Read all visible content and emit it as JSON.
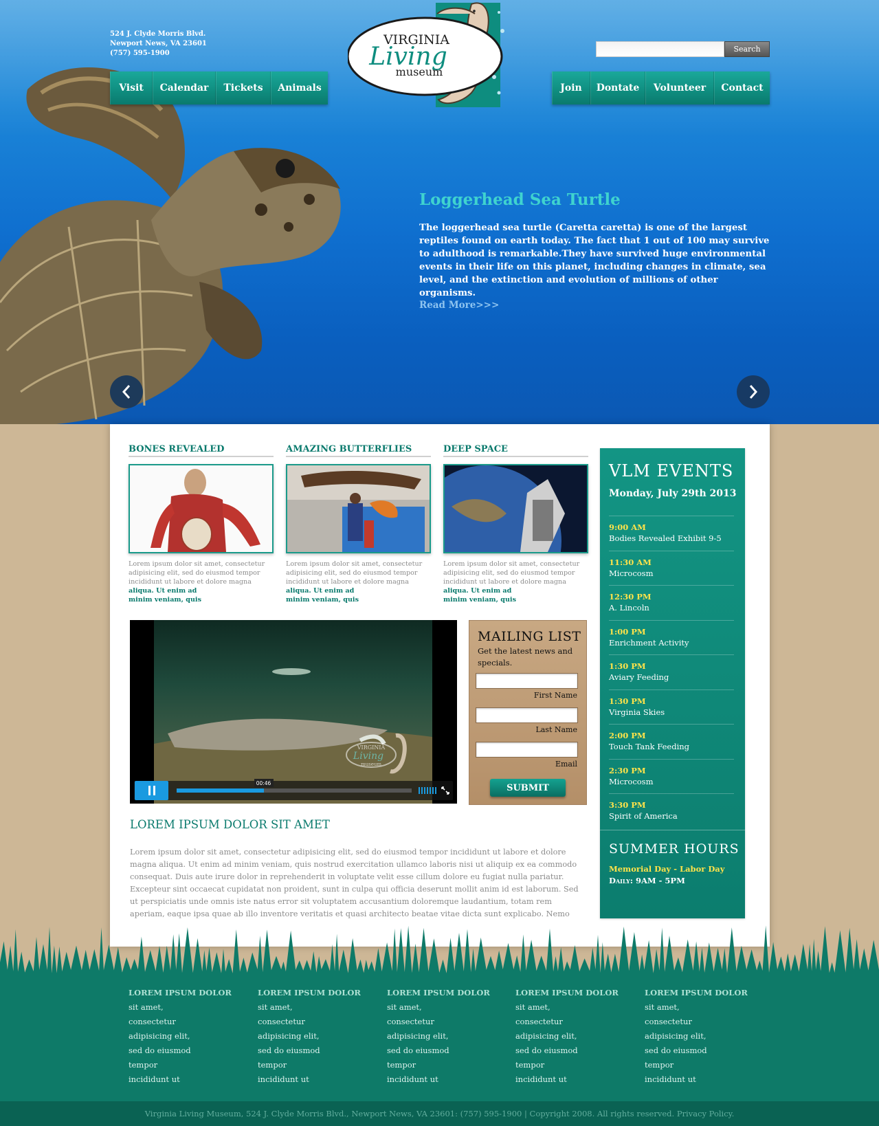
{
  "header": {
    "address": [
      "524 J. Clyde Morris Blvd.",
      "Newport News, VA 23601",
      "(757) 595-1900"
    ],
    "logo": {
      "line1": "VIRGINIA",
      "line2": "Living",
      "line3": "museum"
    },
    "nav_left": [
      "Visit",
      "Calendar",
      "Tickets",
      "Animals"
    ],
    "nav_right": [
      "Join",
      "Dontate",
      "Volunteer",
      "Contact"
    ],
    "search": {
      "value": "",
      "placeholder": "",
      "button": "Search"
    }
  },
  "hero": {
    "title": "Loggerhead Sea Turtle",
    "text": "The loggerhead sea turtle (Caretta caretta) is one of the largest reptiles found on earth today. The fact that 1 out of 100 may survive to adulthood is remarkable.They have survived huge environmental events in their life on this planet, including changes in climate, sea level, and the extinction and evolution of millions of other organisms.",
    "read_more": "Read More>>>"
  },
  "features": [
    {
      "title": "BONES REVEALED",
      "text": "Lorem ipsum dolor sit amet, consectetur adipisicing elit, sed do eiusmod tempor incididunt ut labore et dolore magna",
      "more1": "aliqua. Ut enim ad",
      "more2": "minim veniam, quis"
    },
    {
      "title": "AMAZING BUTTERFLIES",
      "text": "Lorem ipsum dolor sit amet, consectetur adipisicing elit, sed do eiusmod tempor incididunt ut labore et dolore magna",
      "more1": "aliqua. Ut enim ad",
      "more2": "minim veniam, quis"
    },
    {
      "title": "DEEP SPACE",
      "text": "Lorem ipsum dolor sit amet, consectetur adipisicing elit, sed do eiusmod tempor incididunt ut labore et dolore magna",
      "more1": "aliqua. Ut enim ad",
      "more2": "minim veniam, quis"
    }
  ],
  "video": {
    "time": "00:46",
    "progress": 0.37,
    "watermark": {
      "line1": "VIRGINIA",
      "line2": "Living",
      "line3": "museum"
    }
  },
  "mailing": {
    "title": "MAILING LIST",
    "subtitle": "Get the latest news and specials.",
    "first_name": "First Name",
    "last_name": "Last Name",
    "email": "Email",
    "submit": "SUBMIT"
  },
  "events": {
    "title": "VLM EVENTS",
    "date": "Monday, July 29th 2013",
    "items": [
      {
        "time": "9:00 AM",
        "name": "Bodies Revealed Exhibit 9-5"
      },
      {
        "time": "11:30 AM",
        "name": "Microcosm"
      },
      {
        "time": "12:30 PM",
        "name": "A. Lincoln"
      },
      {
        "time": "1:00 PM",
        "name": "Enrichment Activity"
      },
      {
        "time": "1:30 PM",
        "name": "Aviary Feeding"
      },
      {
        "time": "1:30 PM",
        "name": "Virginia Skies"
      },
      {
        "time": "2:00 PM",
        "name": "Touch Tank Feeding"
      },
      {
        "time": "2:30 PM",
        "name": "Microcosm"
      },
      {
        "time": "3:30 PM",
        "name": "Spirit of America"
      }
    ],
    "hours_title": "SUMMER HOURS",
    "hours_range": "Memorial Day - Labor Day",
    "hours_time": "Daily: 9AM - 5PM"
  },
  "article": {
    "title": "LOREM IPSUM DOLOR SIT AMET",
    "text": "Lorem ipsum dolor sit amet, consectetur adipisicing elit, sed do eiusmod tempor incididunt ut labore et dolore magna aliqua. Ut enim ad minim veniam, quis nostrud exercitation ullamco laboris nisi ut aliquip ex ea commodo consequat. Duis aute irure dolor in reprehenderit in voluptate velit esse cillum dolore eu fugiat nulla pariatur. Excepteur sint occaecat cupidatat non proident, sunt in culpa qui officia deserunt mollit anim id est laborum. Sed ut perspiciatis unde omnis iste natus error sit voluptatem accusantium doloremque laudantium, totam rem aperiam, eaque ipsa quae ab illo inventore veritatis et quasi architecto beatae vitae dicta sunt explicabo. Nemo"
  },
  "footer": {
    "columns": [
      {
        "title": "LOREM IPSUM DOLOR",
        "links": [
          "sit amet,",
          "consectetur",
          "adipisicing elit,",
          "sed do eiusmod",
          "tempor",
          "incididunt ut"
        ]
      },
      {
        "title": "LOREM IPSUM DOLOR",
        "links": [
          "sit amet,",
          "consectetur",
          "adipisicing elit,",
          "sed do eiusmod",
          "tempor",
          "incididunt ut"
        ]
      },
      {
        "title": "LOREM IPSUM DOLOR",
        "links": [
          "sit amet,",
          "consectetur",
          "adipisicing elit,",
          "sed do eiusmod",
          "tempor",
          "incididunt ut"
        ]
      },
      {
        "title": "LOREM IPSUM DOLOR",
        "links": [
          "sit amet,",
          "consectetur",
          "adipisicing elit,",
          "sed do eiusmod",
          "tempor",
          "incididunt ut"
        ]
      },
      {
        "title": "LOREM IPSUM DOLOR",
        "links": [
          "sit amet,",
          "consectetur",
          "adipisicing elit,",
          "sed do eiusmod",
          "tempor",
          "incididunt ut"
        ]
      }
    ],
    "bottom": "Virginia Living Museum, 524 J. Clyde Morris Blvd., Newport News, VA 23601:  (757) 595-1900    |    Copyright 2008.   All rights reserved. Privacy Policy."
  },
  "colors": {
    "teal": "#0a7a6d",
    "hero_blue": "#1c86d8",
    "event_time_yellow": "#ffe34a",
    "tan": "#cdb796"
  }
}
